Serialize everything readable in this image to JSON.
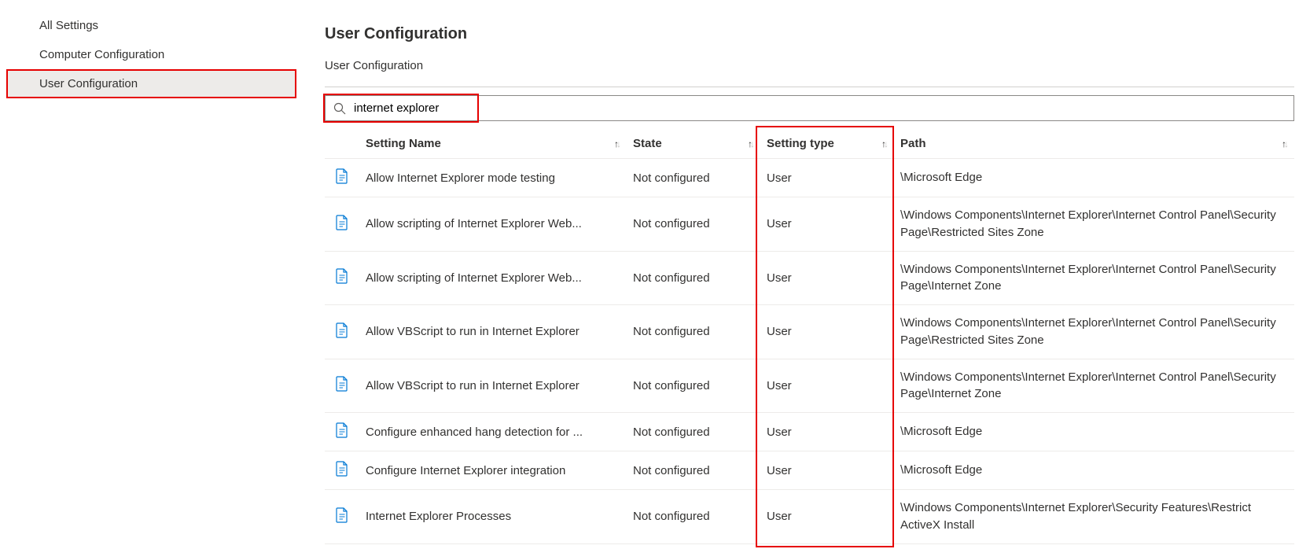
{
  "sidebar": {
    "items": [
      {
        "label": "All Settings"
      },
      {
        "label": "Computer Configuration"
      },
      {
        "label": "User Configuration"
      }
    ]
  },
  "header": {
    "title": "User Configuration",
    "breadcrumb": "User Configuration"
  },
  "search": {
    "value": "internet explorer"
  },
  "columns": {
    "name": "Setting Name",
    "state": "State",
    "type": "Setting type",
    "path": "Path"
  },
  "rows": [
    {
      "name": "Allow Internet Explorer mode testing",
      "state": "Not configured",
      "type": "User",
      "path": "\\Microsoft Edge"
    },
    {
      "name": "Allow scripting of Internet Explorer Web...",
      "state": "Not configured",
      "type": "User",
      "path": "\\Windows Components\\Internet Explorer\\Internet Control Panel\\Security Page\\Restricted Sites Zone"
    },
    {
      "name": "Allow scripting of Internet Explorer Web...",
      "state": "Not configured",
      "type": "User",
      "path": "\\Windows Components\\Internet Explorer\\Internet Control Panel\\Security Page\\Internet Zone"
    },
    {
      "name": "Allow VBScript to run in Internet Explorer",
      "state": "Not configured",
      "type": "User",
      "path": "\\Windows Components\\Internet Explorer\\Internet Control Panel\\Security Page\\Restricted Sites Zone"
    },
    {
      "name": "Allow VBScript to run in Internet Explorer",
      "state": "Not configured",
      "type": "User",
      "path": "\\Windows Components\\Internet Explorer\\Internet Control Panel\\Security Page\\Internet Zone"
    },
    {
      "name": "Configure enhanced hang detection for ...",
      "state": "Not configured",
      "type": "User",
      "path": "\\Microsoft Edge"
    },
    {
      "name": "Configure Internet Explorer integration",
      "state": "Not configured",
      "type": "User",
      "path": "\\Microsoft Edge"
    },
    {
      "name": "Internet Explorer Processes",
      "state": "Not configured",
      "type": "User",
      "path": "\\Windows Components\\Internet Explorer\\Security Features\\Restrict ActiveX Install"
    }
  ]
}
